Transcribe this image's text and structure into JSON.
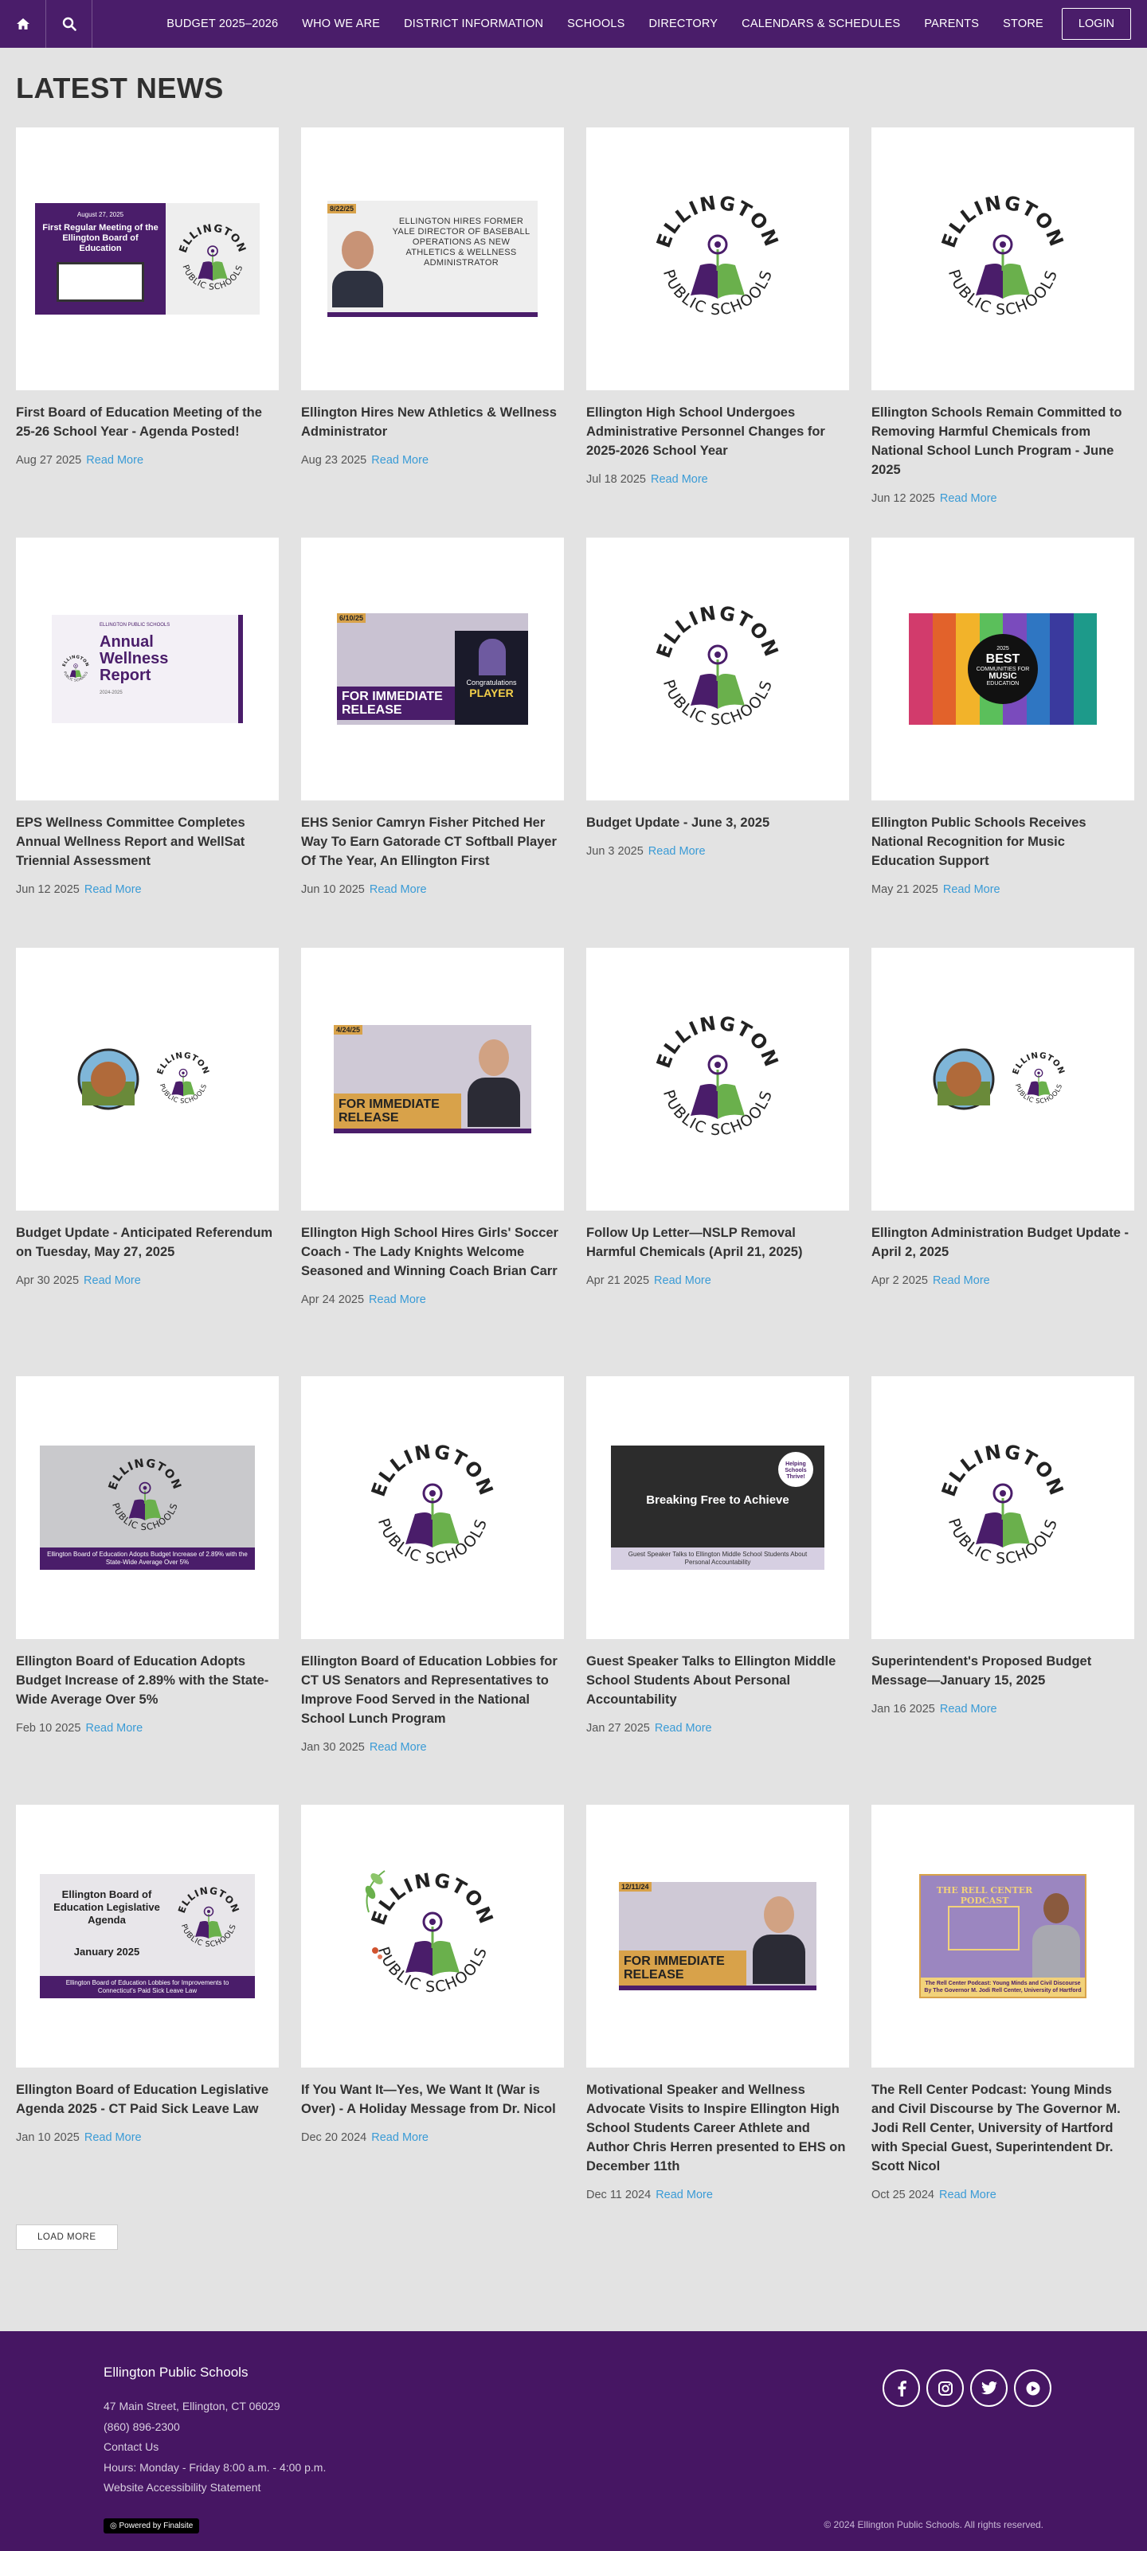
{
  "nav": {
    "home_icon": "home-icon",
    "search_icon": "search-icon",
    "links": [
      "BUDGET 2025–2026",
      "WHO WE ARE",
      "DISTRICT INFORMATION",
      "SCHOOLS",
      "DIRECTORY",
      "CALENDARS & SCHEDULES",
      "PARENTS",
      "STORE"
    ],
    "login": "LOGIN"
  },
  "page": {
    "title": "LATEST NEWS",
    "read_more": "Read More",
    "load_more": "LOAD MORE"
  },
  "colors": {
    "brand_purple": "#4a1d6a",
    "link_blue": "#3a9bd6",
    "logo_green": "#6ab04c"
  },
  "news": [
    {
      "title": "First Board of Education Meeting of the 25-26 School Year - Agenda Posted!",
      "date": "Aug 27 2025",
      "thumb": "bulletin",
      "thumb_text": [
        "August 27, 2025",
        "First Regular Meeting of the Ellington Board of Education"
      ]
    },
    {
      "title": "Ellington Hires New Athletics & Wellness Administrator",
      "date": "Aug 23 2025",
      "thumb": "portrait-announcement",
      "thumb_text": [
        "8/22/25",
        "ELLINGTON HIRES FORMER YALE DIRECTOR OF BASEBALL OPERATIONS AS NEW ATHLETICS & WELLNESS ADMINISTRATOR"
      ]
    },
    {
      "title": "Ellington High School Undergoes Administrative Personnel Changes for 2025-2026 School Year",
      "date": "Jul 18 2025",
      "thumb": "logo",
      "thumb_text": [
        "ELLINGTON",
        "PUBLIC SCHOOLS"
      ]
    },
    {
      "title": "Ellington Schools Remain Committed to Removing Harmful Chemicals from National School Lunch Program - June 2025",
      "date": "Jun 12 2025",
      "thumb": "logo",
      "thumb_text": [
        "ELLINGTON",
        "PUBLIC SCHOOLS"
      ]
    },
    {
      "title": "EPS Wellness Committee Completes Annual Wellness Report and WellSat Triennial Assessment",
      "date": "Jun 12 2025",
      "thumb": "report",
      "thumb_text": [
        "ELLINGTON PUBLIC SCHOOLS",
        "Annual Wellness Report",
        "2024-2025"
      ]
    },
    {
      "title": "EHS Senior Camryn Fisher Pitched Her Way To Earn Gatorade CT Softball Player Of The Year, An Ellington First",
      "date": "Jun 10 2025",
      "thumb": "release-photo",
      "thumb_text": [
        "6/10/25",
        "FOR IMMEDIATE RELEASE",
        "Congratulations",
        "PLAYER"
      ]
    },
    {
      "title": "Budget Update - June 3, 2025",
      "date": "Jun 3 2025",
      "thumb": "logo",
      "thumb_text": [
        "ELLINGTON",
        "PUBLIC SCHOOLS"
      ]
    },
    {
      "title": "Ellington Public Schools Receives National Recognition for Music Education Support",
      "date": "May 21 2025",
      "thumb": "music",
      "thumb_text": [
        "2025",
        "BEST",
        "COMMUNITIES FOR",
        "MUSIC",
        "EDUCATION"
      ]
    },
    {
      "title": "Budget Update - Anticipated Referendum on Tuesday, May 27, 2025",
      "date": "Apr 30 2025",
      "thumb": "two-seals",
      "thumb_text": [
        "ELLINGTON",
        "PUBLIC SCHOOLS"
      ]
    },
    {
      "title": "Ellington High School Hires Girls' Soccer Coach - The Lady Knights Welcome Seasoned and Winning Coach Brian Carr",
      "date": "Apr 24 2025",
      "thumb": "release-portrait",
      "thumb_text": [
        "4/24/25",
        "FOR IMMEDIATE RELEASE"
      ]
    },
    {
      "title": "Follow Up Letter—NSLP Removal Harmful Chemicals (April 21, 2025)",
      "date": "Apr 21 2025",
      "thumb": "logo",
      "thumb_text": [
        "ELLINGTON",
        "PUBLIC SCHOOLS"
      ]
    },
    {
      "title": "Ellington Administration Budget Update - April 2, 2025",
      "date": "Apr 2 2025",
      "thumb": "two-seals",
      "thumb_text": [
        "ELLINGTON",
        "PUBLIC SCHOOLS"
      ]
    },
    {
      "title": "Ellington Board of Education Adopts Budget Increase of 2.89% with the State-Wide Average Over 5%",
      "date": "Feb 10 2025",
      "thumb": "banner-photo",
      "thumb_text": [
        "ELLINGTON",
        "PUBLIC SCHOOLS",
        "Ellington Board of Education Adopts Budget Increase of 2.89% with the State-Wide Average Over 5%"
      ]
    },
    {
      "title": "Ellington Board of Education Lobbies for CT US Senators and Representatives to Improve Food Served in the National School Lunch Program",
      "date": "Jan 30 2025",
      "thumb": "logo",
      "thumb_text": [
        "ELLINGTON",
        "PUBLIC SCHOOLS"
      ]
    },
    {
      "title": "Guest Speaker Talks to Ellington Middle School Students About Personal Accountability",
      "date": "Jan 27 2025",
      "thumb": "speaker",
      "thumb_text": [
        "Breaking Free to Achieve",
        "Guest Speaker Talks to Ellington Middle School Students About Personal Accountability",
        "Helping Schools Thrive!"
      ]
    },
    {
      "title": "Superintendent's Proposed Budget Message—January 15, 2025",
      "date": "Jan 16 2025",
      "thumb": "logo",
      "thumb_text": [
        "ELLINGTON",
        "PUBLIC SCHOOLS"
      ]
    },
    {
      "title": "Ellington Board of Education Legislative Agenda 2025 - CT Paid Sick Leave Law",
      "date": "Jan 10 2025",
      "thumb": "agenda",
      "thumb_text": [
        "Ellington Board of Education Legislative Agenda",
        "January 2025",
        "Ellington Board of Education Lobbies for Improvements to Connecticut's Paid Sick Leave Law"
      ]
    },
    {
      "title": "If You Want It—Yes, We Want It (War is Over) - A Holiday Message from Dr. Nicol",
      "date": "Dec 20 2024",
      "thumb": "holiday-logo",
      "thumb_text": [
        "ELLINGTON",
        "PUBLIC SCHOOLS"
      ]
    },
    {
      "title": "Motivational Speaker and Wellness Advocate Visits to Inspire Ellington High School Students Career Athlete and Author Chris Herren presented to EHS on December 11th",
      "date": "Dec 11 2024",
      "thumb": "release-portrait",
      "thumb_text": [
        "12/11/24",
        "FOR IMMEDIATE RELEASE"
      ]
    },
    {
      "title": "The Rell Center Podcast: Young Minds and Civil Discourse by The Governor M. Jodi Rell Center, University of Hartford with Special Guest, Superintendent Dr. Scott Nicol",
      "date": "Oct 25 2024",
      "thumb": "podcast",
      "thumb_text": [
        "THE RELL CENTER PODCAST",
        "The Rell Center Podcast: Young Minds and Civil Discourse",
        "By The Governor M. Jodi Rell Center, University of Hartford"
      ]
    }
  ],
  "footer": {
    "org": "Ellington Public Schools",
    "address": "47 Main Street, Ellington, CT 06029",
    "phone": "(860) 896-2300",
    "contact": "Contact Us",
    "hours": "Hours: Monday - Friday 8:00 a.m. - 4:00 p.m.",
    "accessibility": "Website Accessibility Statement",
    "powered": "Powered by Finalsite",
    "copyright": "© 2024 Ellington Public Schools. All rights reserved.",
    "social": [
      "facebook-icon",
      "instagram-icon",
      "twitter-icon",
      "youtube-icon"
    ]
  }
}
